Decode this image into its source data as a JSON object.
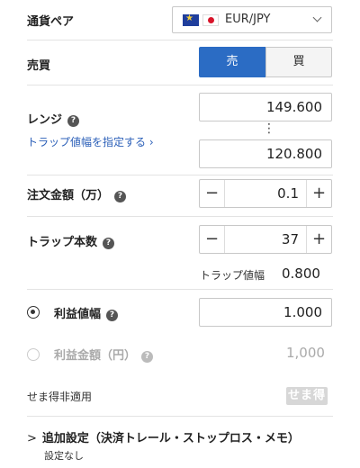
{
  "pair": {
    "label": "通貨ペア",
    "value": "EUR/JPY"
  },
  "side": {
    "label": "売買",
    "sell": "売",
    "buy": "買",
    "selected": "sell"
  },
  "range": {
    "label": "レンジ",
    "help": "?",
    "upper": "149.600",
    "lower": "120.800",
    "separator": "⋮",
    "trap_link": "トラップ値幅を指定する ›"
  },
  "order_amount": {
    "label": "注文金額（万）",
    "help": "?",
    "value": "0.1",
    "minus": "−",
    "plus": "+"
  },
  "trap_count": {
    "label": "トラップ本数",
    "help": "?",
    "value": "37",
    "minus": "−",
    "plus": "+"
  },
  "trap_width": {
    "label": "トラップ値幅",
    "value": "0.800"
  },
  "profit_width": {
    "label": "利益値幅",
    "help": "?",
    "value": "1.000",
    "selected": true
  },
  "profit_amount": {
    "label": "利益金額（円）",
    "help": "?",
    "value": "1,000",
    "selected": false
  },
  "semaru": {
    "label": "せま得非適用",
    "badge": "せま得"
  },
  "additional": {
    "label": "追加設定（決済トレール・ストップロス・メモ）",
    "sub": "設定なし",
    "chevron": ">"
  },
  "colors": {
    "accent": "#2b6cc4",
    "link": "#2b5fb8"
  },
  "icons": [
    "eu-flag-icon",
    "jp-flag-icon",
    "chevron-down-icon",
    "help-icon",
    "radio-icon"
  ]
}
